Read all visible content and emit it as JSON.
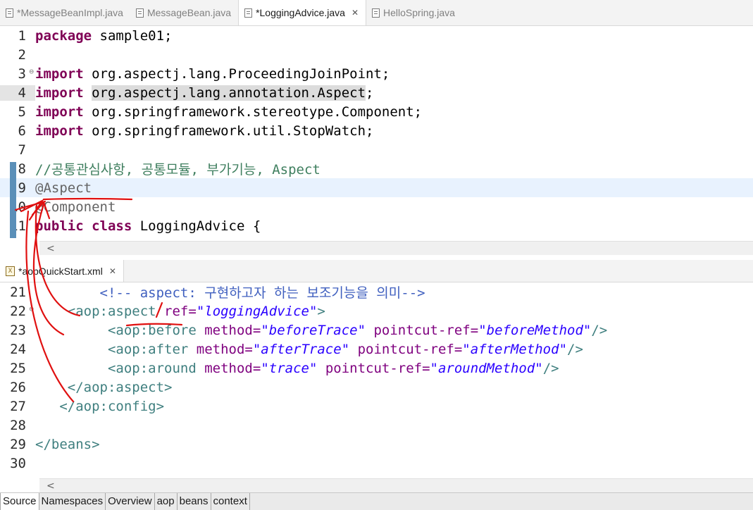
{
  "top_tabs": [
    {
      "label": "*MessageBeanImpl.java",
      "active": false
    },
    {
      "label": "MessageBean.java",
      "active": false
    },
    {
      "label": "*LoggingAdvice.java",
      "active": true
    },
    {
      "label": "HelloSpring.java",
      "active": false
    }
  ],
  "java_editor": {
    "line_numbers": [
      "1",
      "2",
      "3",
      "4",
      "5",
      "6",
      "7",
      "8",
      "9",
      "10",
      "11"
    ],
    "l1_kw": "package",
    "l1_rest": " sample01;",
    "l3_kw": "import",
    "l3_rest": " org.aspectj.lang.ProceedingJoinPoint;",
    "l4_kw": "import",
    "l4_sel": "org.aspectj.lang.annotation.Aspect",
    "l4_end": ";",
    "l5_kw": "import",
    "l5_rest": " org.springframework.stereotype.Component;",
    "l6_kw": "import",
    "l6_rest": " org.springframework.util.StopWatch;",
    "l8_comment": "//공통관심사항, 공통모듈, 부가기능, Aspect",
    "l9_annotation": "@Aspect",
    "l10_annotation": "@Component",
    "l11_kw": "public class",
    "l11_rest": " LoggingAdvice {"
  },
  "scroll_arrow": "<",
  "xml_tab": {
    "label": "*aopQuickStart.xml",
    "icon": "xml-file-icon",
    "icon_glyph": "X"
  },
  "xml_editor": {
    "line_numbers": [
      "21",
      "22",
      "23",
      "24",
      "25",
      "26",
      "27",
      "28",
      "29",
      "30"
    ],
    "l21_comment": "<!-- aspect: 구현하고자 하는 보조기능을 의미-->",
    "l22_tag": "<aop:aspect",
    "l22_attr": " ref=",
    "l22_val": "\"loggingAdvice\"",
    "l22_close": ">",
    "l23_tag": "<aop:before",
    "l23_a1": " method=",
    "l23_v1": "\"beforeTrace\"",
    "l23_a2": " pointcut-ref=",
    "l23_v2": "\"beforeMethod\"",
    "l23_close": "/>",
    "l24_tag": "<aop:after",
    "l24_a1": " method=",
    "l24_v1": "\"afterTrace\"",
    "l24_a2": " pointcut-ref=",
    "l24_v2": "\"afterMethod\"",
    "l24_close": "/>",
    "l25_tag": "<aop:around",
    "l25_a1": " method=",
    "l25_v1": "\"trace\"",
    "l25_a2": " pointcut-ref=",
    "l25_v2": "\"aroundMethod\"",
    "l25_close": "/>",
    "l26_tag": "</aop:aspect>",
    "l27_tag": "</aop:config>",
    "l29_tag": "</beans>"
  },
  "page_tabs": [
    {
      "label": "Source",
      "active": true
    },
    {
      "label": "Namespaces",
      "active": false
    },
    {
      "label": "Overview",
      "active": false
    },
    {
      "label": "aop",
      "active": false
    },
    {
      "label": "beans",
      "active": false
    },
    {
      "label": "context",
      "active": false
    }
  ],
  "colors": {
    "keyword": "#7f0055",
    "comment": "#3f7f5f",
    "annotation": "#646464",
    "xml_tag": "#3f7f7f",
    "xml_attr": "#7f007f",
    "xml_value": "#2a00ff",
    "xml_comment": "#3f5fbf",
    "ink": "#e01010"
  }
}
